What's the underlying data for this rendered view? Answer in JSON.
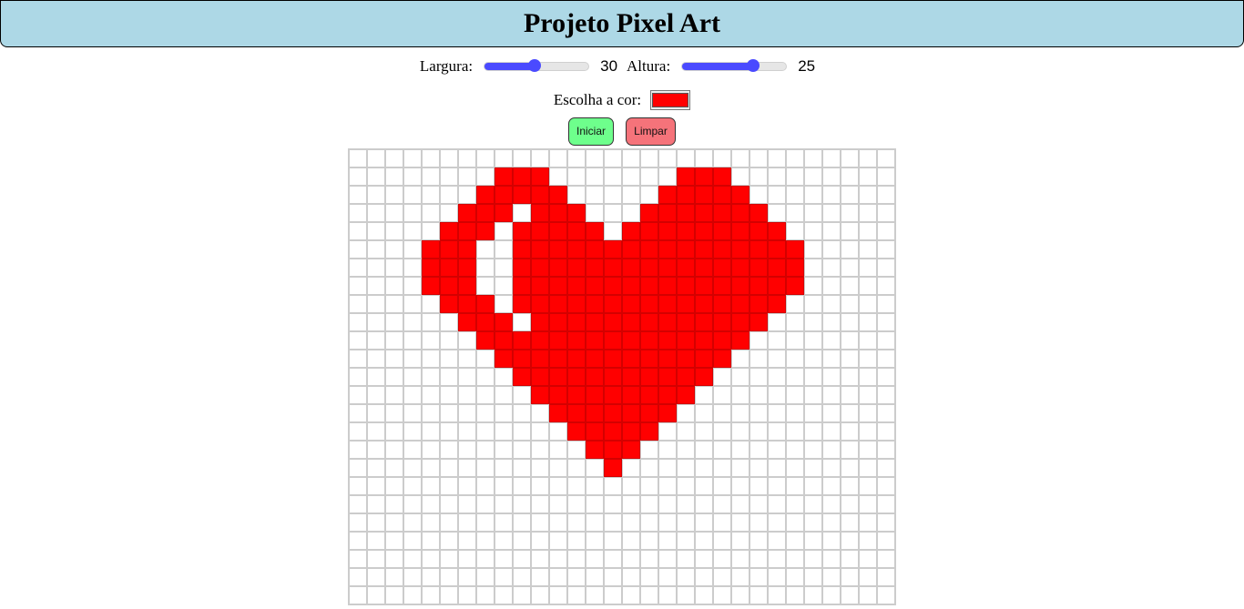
{
  "header": {
    "title": "Projeto Pixel Art"
  },
  "controls": {
    "width_label": "Largura:",
    "width_value": "30",
    "width_fraction": 0.48,
    "height_label": "Altura:",
    "height_value": "25",
    "height_fraction": 0.68,
    "color_label": "Escolha a cor:",
    "color_value": "#ff0000",
    "start_label": "Iniciar",
    "clear_label": "Limpar"
  },
  "colors": {
    "header_bg": "#add8e6",
    "start_bg": "#6eff8c",
    "clear_bg": "#f5737a",
    "slider": "#4a4aff",
    "paint": "#ff0000"
  },
  "grid": {
    "columns": 30,
    "rows": 25,
    "painted": [
      "..............................",
      "........###.......###.........",
      ".......#####.....#####........",
      "......###.###...#######.......",
      ".....###.#####.#########......",
      "....###..################.....",
      "....###..################.....",
      "....###..################.....",
      ".....###.###############......",
      "......###.#############.......",
      ".......###############........",
      "........#############.........",
      ".........###########..........",
      "..........#########...........",
      "...........#######............",
      "............#####.............",
      ".............###..............",
      "..............#...............",
      "..............................",
      "..............................",
      "..............................",
      "..............................",
      "..............................",
      "..............................",
      ".............................."
    ]
  }
}
